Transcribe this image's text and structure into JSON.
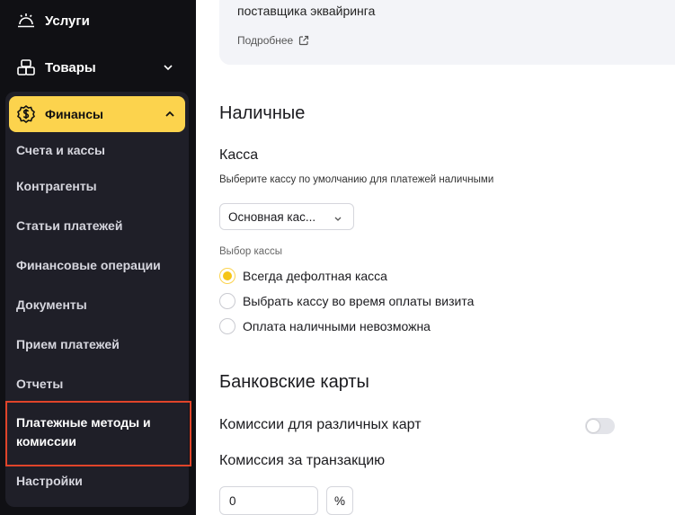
{
  "sidebar": {
    "services_label": "Услуги",
    "goods_label": "Товары",
    "finance_label": "Финансы",
    "finance_items": [
      "Счета и кассы",
      "Контрагенты",
      "Статьи платежей",
      "Финансовые операции",
      "Документы",
      "Прием платежей",
      "Отчеты",
      "Платежные методы и комиссии",
      "Настройки"
    ],
    "active_item": "Платежные методы и комиссии"
  },
  "main": {
    "card": {
      "text": "поставщика эквайринга",
      "more_link": "Подробнее"
    },
    "cash_title": "Наличные",
    "register_title": "Касса",
    "register_hint": "Выберите кассу по умолчанию для платежей наличными",
    "register_select_value": "Основная кас...",
    "register_choice_label": "Выбор кассы",
    "radio_options": [
      {
        "label": "Всегда дефолтная касса",
        "checked": true
      },
      {
        "label": "Выбрать кассу во время оплаты визита",
        "checked": false
      },
      {
        "label": "Оплата наличными невозможна",
        "checked": false
      }
    ],
    "cards_title": "Банковские карты",
    "commission_cards_label": "Комиссии для различных карт",
    "commission_cards_enabled": false,
    "transaction_fee_label": "Комиссия за транзакцию",
    "transaction_fee_value": "0",
    "transaction_fee_unit": "%"
  },
  "colors": {
    "sidebar_bg": "#101014",
    "panel_bg": "#1f1f28",
    "accent_yellow": "#fcd34d",
    "highlight_red": "#e0442a"
  }
}
